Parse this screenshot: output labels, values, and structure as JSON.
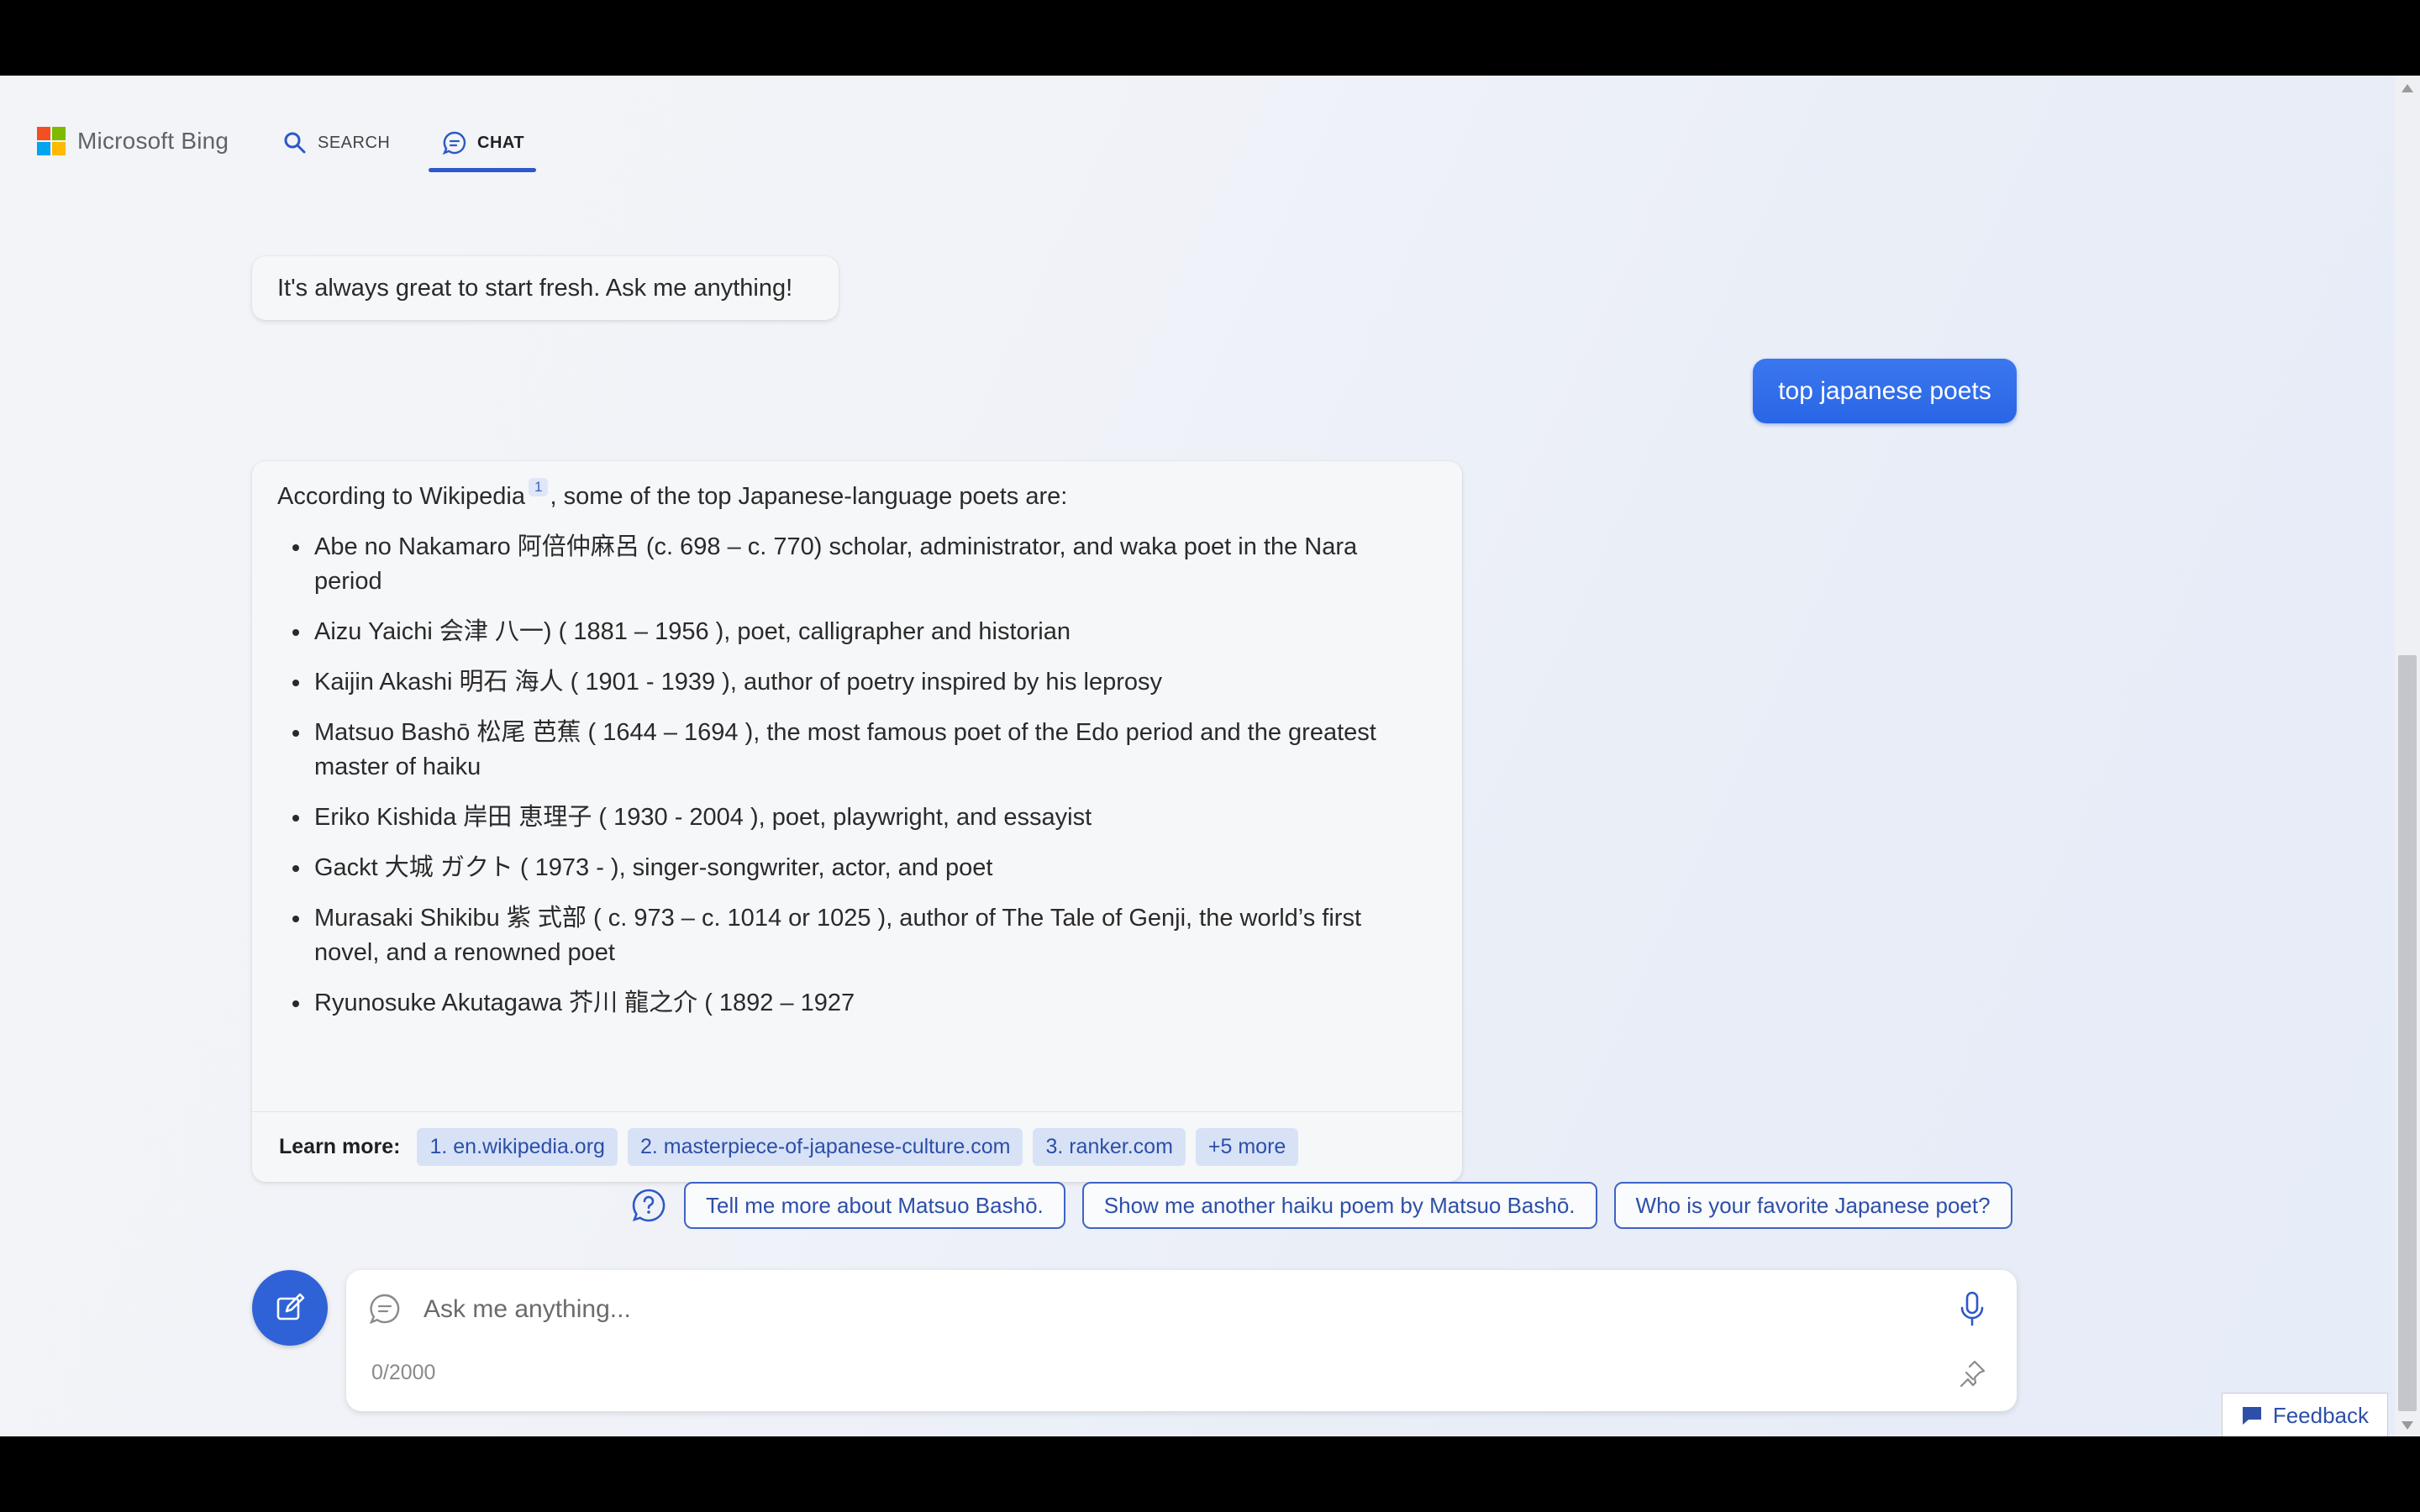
{
  "header": {
    "brand": "Microsoft Bing",
    "brand_colors": [
      "#f25022",
      "#7fba00",
      "#00a4ef",
      "#ffb900"
    ],
    "nav": {
      "search_label": "SEARCH",
      "chat_label": "CHAT",
      "active": "chat"
    }
  },
  "conversation": {
    "greeting": "It's always great to start fresh. Ask me anything!",
    "user_message": "top japanese poets",
    "answer": {
      "intro_before": "According to Wikipedia",
      "citation": "1",
      "intro_after": ", some of the top Japanese-language poets are:",
      "poets": [
        "Abe no Nakamaro 阿倍仲麻呂 (c. 698 – c. 770) scholar, administrator, and waka poet in the Nara period",
        "Aizu Yaichi 会津 八一) ( 1881 – 1956 ), poet, calligrapher and historian",
        "Kaijin Akashi 明石 海人 ( 1901 - 1939 ), author of poetry inspired by his leprosy",
        "Matsuo Bashō 松尾 芭蕉 ( 1644 – 1694 ), the most famous poet of the Edo period and the greatest master of haiku",
        "Eriko Kishida 岸田 恵理子 ( 1930 - 2004 ), poet, playwright, and essayist",
        "Gackt 大城 ガクト ( 1973 - ), singer-songwriter, actor, and poet",
        "Murasaki Shikibu 紫 式部 ( c. 973 – c. 1014 or 1025 ), author of The Tale of Genji, the world’s first novel, and a renowned poet",
        "Ryunosuke Akutagawa 芥川 龍之介 ( 1892 – 1927"
      ],
      "learn_more_label": "Learn more:",
      "sources": [
        "1. en.wikipedia.org",
        "2. masterpiece-of-japanese-culture.com",
        "3. ranker.com",
        "+5 more"
      ]
    }
  },
  "suggestions": [
    "Tell me more about Matsuo Bashō.",
    "Show me another haiku poem by Matsuo Bashō.",
    "Who is your favorite Japanese poet?"
  ],
  "composer": {
    "placeholder": "Ask me anything...",
    "value": "",
    "counter": "0/2000"
  },
  "feedback_label": "Feedback",
  "colors": {
    "accent": "#2d58c8",
    "user_bubble": "#2f6ce9",
    "chip_bg": "#d8e2f6"
  }
}
